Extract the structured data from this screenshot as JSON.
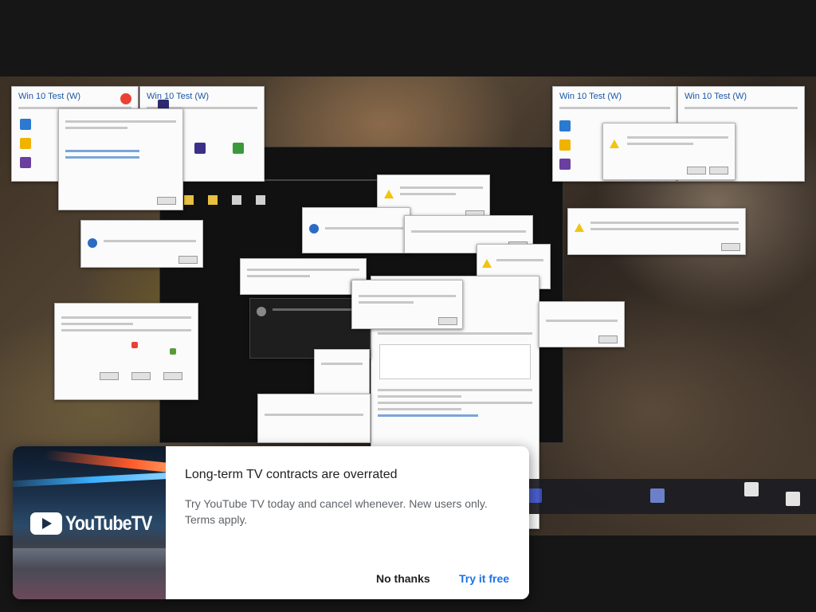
{
  "background_video": {
    "dialogs": [
      {
        "title": "Win 10 Test (W)"
      },
      {
        "title": "Win 10 Test (W)"
      },
      {
        "title": "Win 10 Test (W)"
      },
      {
        "title": "Win 10 Test (W)"
      }
    ]
  },
  "ad": {
    "brand": "YouTubeTV",
    "title": "Long-term TV contracts are overrated",
    "body": "Try YouTube TV today and cancel whenever. New users only. Terms apply.",
    "dismiss_label": "No thanks",
    "cta_label": "Try it free",
    "colors": {
      "cta": "#1a73e8",
      "title": "#202124",
      "body": "#5f6368"
    }
  }
}
